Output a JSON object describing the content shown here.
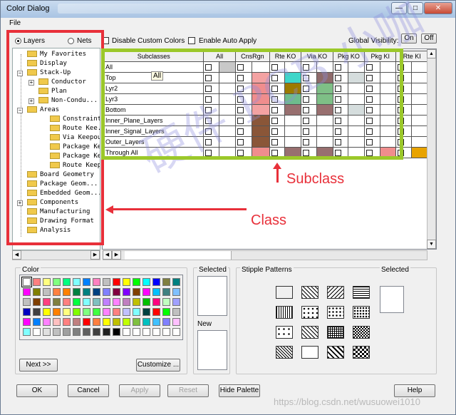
{
  "window": {
    "title": "Color Dialog",
    "menu_file": "File"
  },
  "tabs": {
    "layers": "Layers",
    "nets": "Nets"
  },
  "options": {
    "disable_custom_colors": "Disable Custom Colors",
    "enable_auto_apply": "Enable Auto Apply",
    "global_visibility": "Global Visibility:",
    "on": "On",
    "off": "Off"
  },
  "tree": [
    {
      "label": "My Favorites"
    },
    {
      "label": "Display"
    },
    {
      "label": "Stack-Up"
    },
    {
      "label": "Conductor"
    },
    {
      "label": "Plan"
    },
    {
      "label": "Non-Condu..."
    },
    {
      "label": "Areas"
    },
    {
      "label": "Constraint Re"
    },
    {
      "label": "Route Kee..."
    },
    {
      "label": "Via Keepout"
    },
    {
      "label": "Package Kee..."
    },
    {
      "label": "Package Ke..."
    },
    {
      "label": "Route Keepin"
    },
    {
      "label": "Board Geometry"
    },
    {
      "label": "Package Geom..."
    },
    {
      "label": "Embedded Geom..."
    },
    {
      "label": "Components"
    },
    {
      "label": "Manufacturing"
    },
    {
      "label": "Drawing Format"
    },
    {
      "label": "Analysis"
    }
  ],
  "grid": {
    "columns": [
      "Subclasses",
      "All",
      "CnsRgn",
      "Rte KO",
      "Via KO",
      "Pkg KO",
      "Pkg KI",
      "Rte KI"
    ],
    "rows": [
      "All",
      "Top",
      "Lyr2",
      "Lyr3",
      "Bottom",
      "Inner_Plane_Layers",
      "Inner_Signal_Layers",
      "Outer_Layers",
      "Through All"
    ],
    "tooltip": "All"
  },
  "palette": {
    "label": "Color",
    "next": "Next >>",
    "customize": "Customize ..."
  },
  "selected": {
    "label": "Selected",
    "new": "New"
  },
  "stipple": {
    "label": "Stipple Patterns",
    "selected": "Selected"
  },
  "buttons": {
    "ok": "OK",
    "cancel": "Cancel",
    "apply": "Apply",
    "reset": "Reset",
    "hide_palette": "Hide Palette",
    "help": "Help"
  },
  "annotations": {
    "subclass": "Subclass",
    "class": "Class",
    "watermark": "硬件 PCB 小咖",
    "csdn": "https://blog.csdn.net/wusuowei1010"
  },
  "colors": {
    "red_annot": "#e8303a",
    "green_box": "#9bc82a"
  }
}
